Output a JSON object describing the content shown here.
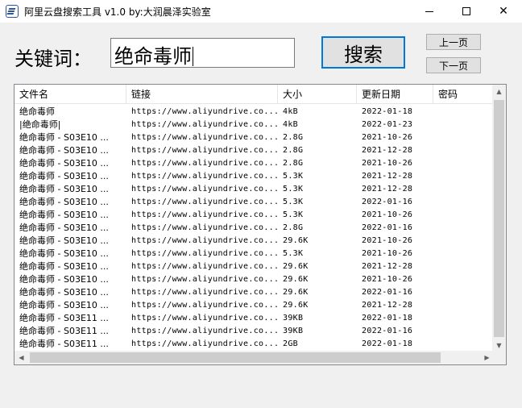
{
  "window": {
    "title": "阿里云盘搜索工具 v1.0  by:大润晨泽实验室"
  },
  "search": {
    "label": "关键词：",
    "value": "绝命毒师",
    "button_label": "搜索"
  },
  "paging": {
    "prev_label": "上一页",
    "next_label": "下一页"
  },
  "table": {
    "columns": [
      "文件名",
      "链接",
      "大小",
      "更新日期",
      "密码"
    ],
    "rows": [
      {
        "name": "绝命毒师",
        "link": "https://www.aliyundrive.co...",
        "size": "4kB",
        "date": "2022-01-18",
        "password": ""
      },
      {
        "name": "|绝命毒师|",
        "link": "https://www.aliyundrive.co...",
        "size": "4kB",
        "date": "2022-01-23",
        "password": ""
      },
      {
        "name": "绝命毒师 - S03E10 ...",
        "link": "https://www.aliyundrive.co...",
        "size": "2.8G",
        "date": "2021-10-26",
        "password": ""
      },
      {
        "name": "绝命毒师 - S03E10 ...",
        "link": "https://www.aliyundrive.co...",
        "size": "2.8G",
        "date": "2021-12-28",
        "password": ""
      },
      {
        "name": "绝命毒师 - S03E10 ...",
        "link": "https://www.aliyundrive.co...",
        "size": "2.8G",
        "date": "2021-10-26",
        "password": ""
      },
      {
        "name": "绝命毒师 - S03E10 ...",
        "link": "https://www.aliyundrive.co...",
        "size": "5.3K",
        "date": "2021-12-28",
        "password": ""
      },
      {
        "name": "绝命毒师 - S03E10 ...",
        "link": "https://www.aliyundrive.co...",
        "size": "5.3K",
        "date": "2021-12-28",
        "password": ""
      },
      {
        "name": "绝命毒师 - S03E10 ...",
        "link": "https://www.aliyundrive.co...",
        "size": "5.3K",
        "date": "2022-01-16",
        "password": ""
      },
      {
        "name": "绝命毒师 - S03E10 ...",
        "link": "https://www.aliyundrive.co...",
        "size": "5.3K",
        "date": "2021-10-26",
        "password": ""
      },
      {
        "name": "绝命毒师 - S03E10 ...",
        "link": "https://www.aliyundrive.co...",
        "size": "2.8G",
        "date": "2022-01-16",
        "password": ""
      },
      {
        "name": "绝命毒师 - S03E10 ...",
        "link": "https://www.aliyundrive.co...",
        "size": "29.6K",
        "date": "2021-10-26",
        "password": ""
      },
      {
        "name": "绝命毒师 - S03E10 ...",
        "link": "https://www.aliyundrive.co...",
        "size": "5.3K",
        "date": "2021-10-26",
        "password": ""
      },
      {
        "name": "绝命毒师 - S03E10 ...",
        "link": "https://www.aliyundrive.co...",
        "size": "29.6K",
        "date": "2021-12-28",
        "password": ""
      },
      {
        "name": "绝命毒师 - S03E10 ...",
        "link": "https://www.aliyundrive.co...",
        "size": "29.6K",
        "date": "2021-10-26",
        "password": ""
      },
      {
        "name": "绝命毒师 - S03E10 ...",
        "link": "https://www.aliyundrive.co...",
        "size": "29.6K",
        "date": "2022-01-16",
        "password": ""
      },
      {
        "name": "绝命毒师 - S03E10 ...",
        "link": "https://www.aliyundrive.co...",
        "size": "29.6K",
        "date": "2021-12-28",
        "password": ""
      },
      {
        "name": "绝命毒师 - S03E11 ...",
        "link": "https://www.aliyundrive.co...",
        "size": "39KB",
        "date": "2022-01-18",
        "password": ""
      },
      {
        "name": "绝命毒师 - S03E11 ...",
        "link": "https://www.aliyundrive.co...",
        "size": "39KB",
        "date": "2022-01-16",
        "password": ""
      },
      {
        "name": "绝命毒师 - S03E11 ...",
        "link": "https://www.aliyundrive.co...",
        "size": "2GB",
        "date": "2022-01-18",
        "password": ""
      }
    ]
  },
  "icons": {
    "app": "app-logo-icon",
    "minimize": "minimize-icon",
    "maximize": "maximize-icon",
    "close": "close-icon"
  },
  "colors": {
    "focus_border": "#0078d7",
    "window_bg": "#f0f0f0"
  }
}
